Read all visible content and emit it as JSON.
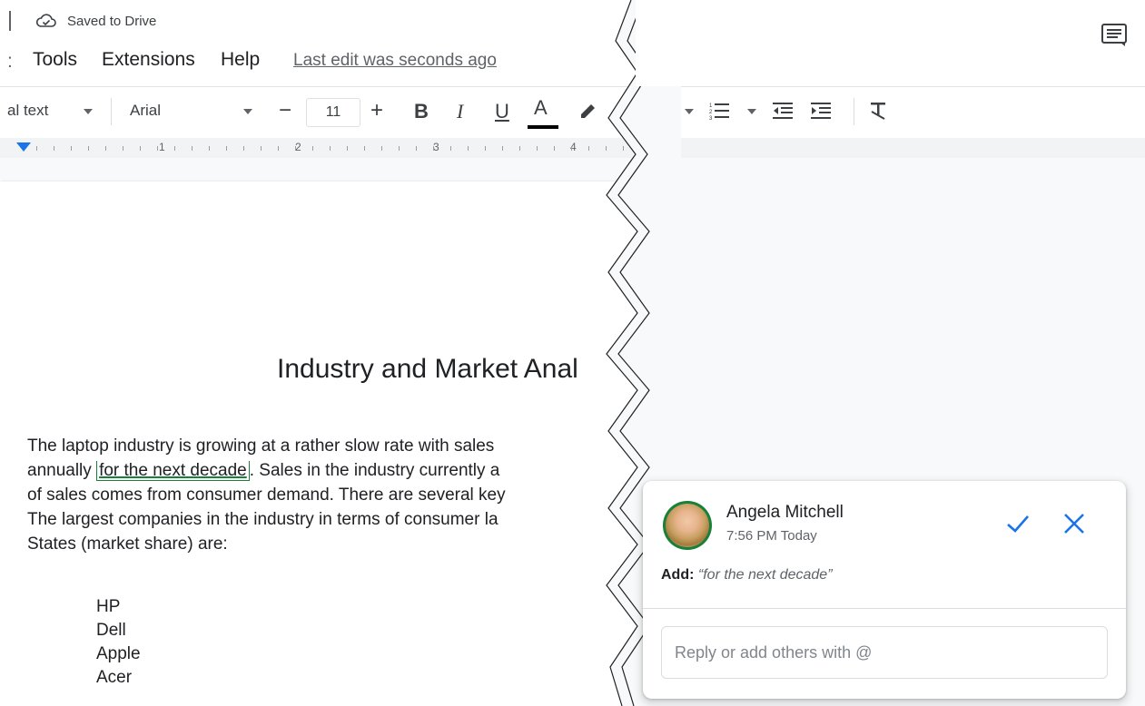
{
  "titlebar": {
    "saved_label": "Saved to Drive"
  },
  "menubar": {
    "items": [
      "Tools",
      "Extensions",
      "Help"
    ],
    "last_edit": "Last edit was seconds ago"
  },
  "toolbar": {
    "style_label": "al text",
    "font_label": "Arial",
    "font_size": "11",
    "decrease_label": "−",
    "increase_label": "+",
    "bold_label": "B",
    "italic_label": "I",
    "underline_label": "U",
    "textcolor_label": "A"
  },
  "ruler": {
    "numbers": [
      "1",
      "2",
      "3",
      "4"
    ]
  },
  "document": {
    "title": "Industry and Market Anal",
    "paragraph_lines": [
      [
        "The laptop industry is growing at a rather slow rate with sales",
        "",
        ""
      ],
      [
        "annually",
        "for the next decade",
        ".  Sales in the industry currently a"
      ],
      [
        "of sales comes from consumer demand. There are several key",
        "",
        ""
      ],
      [
        "The largest companies in the industry in terms of consumer la",
        "",
        ""
      ],
      [
        "States (market share) are:",
        "",
        ""
      ]
    ],
    "list": [
      "HP",
      "Dell",
      "Apple",
      "Acer"
    ]
  },
  "comment": {
    "author": "Angela Mitchell",
    "time": "7:56 PM Today",
    "action_label": "Add:",
    "action_text": "“for the next decade”",
    "reply_placeholder": "Reply or add others with @"
  },
  "colors": {
    "accent": "#1a73e8",
    "suggestion": "#188038"
  }
}
